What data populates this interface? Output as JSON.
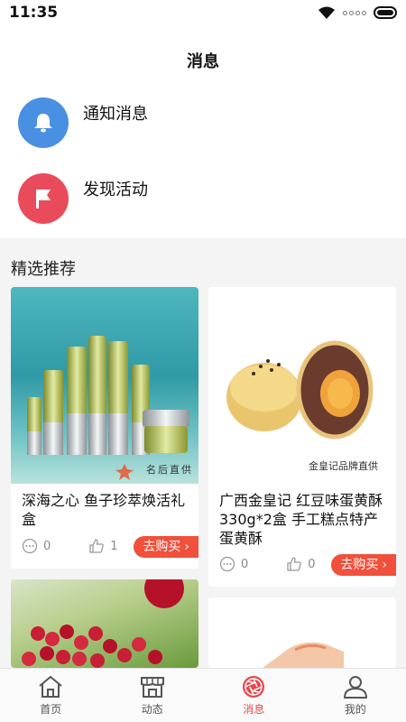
{
  "status_bar": {
    "time": "11:35"
  },
  "header": {
    "title": "消息"
  },
  "messages": [
    {
      "label": "通知消息",
      "icon": "bell-icon",
      "color": "#4a90e2"
    },
    {
      "label": "发现活动",
      "icon": "flag-icon",
      "color": "#ea4b5a"
    }
  ],
  "section": {
    "title": "精选推荐"
  },
  "products": [
    {
      "title": "深海之心 鱼子珍萃焕活礼盒",
      "image_caption": "名后直供",
      "comments": "0",
      "likes": "1",
      "buy_label": "去购买"
    },
    {
      "title": "广西金皇记 红豆味蛋黄酥 330g*2盒 手工糕点特产蛋黄酥",
      "image_caption": "金皇记品牌直供",
      "comments": "0",
      "likes": "0",
      "buy_label": "去购买"
    }
  ],
  "tabbar": {
    "tabs": [
      {
        "label": "首页",
        "icon": "home-icon"
      },
      {
        "label": "动态",
        "icon": "store-icon"
      },
      {
        "label": "消息",
        "icon": "aperture-icon",
        "active": true
      },
      {
        "label": "我的",
        "icon": "user-icon"
      }
    ]
  },
  "colors": {
    "accent": "#e8474c",
    "buy_button": "#f0503c"
  }
}
